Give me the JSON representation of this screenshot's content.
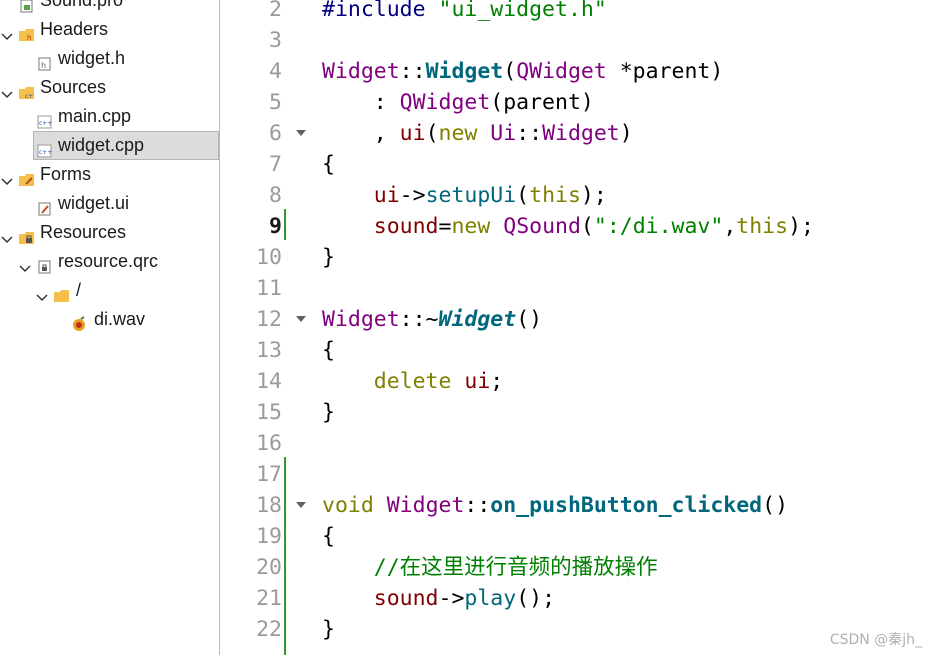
{
  "tree": {
    "items": [
      {
        "label": "Sound.pro",
        "icon": "pro-file-icon"
      },
      {
        "label": "Headers",
        "icon": "headers-folder-icon"
      },
      {
        "label": "widget.h",
        "icon": "header-file-icon"
      },
      {
        "label": "Sources",
        "icon": "sources-folder-icon"
      },
      {
        "label": "main.cpp",
        "icon": "cpp-file-icon"
      },
      {
        "label": "widget.cpp",
        "icon": "cpp-file-icon",
        "selected": true
      },
      {
        "label": "Forms",
        "icon": "forms-folder-icon"
      },
      {
        "label": "widget.ui",
        "icon": "ui-file-icon"
      },
      {
        "label": "Resources",
        "icon": "resources-folder-icon"
      },
      {
        "label": "resource.qrc",
        "icon": "qrc-file-icon"
      },
      {
        "label": "/",
        "icon": "folder-icon"
      },
      {
        "label": "di.wav",
        "icon": "audio-file-icon"
      }
    ]
  },
  "editor": {
    "current_line": 9,
    "lines": [
      {
        "n": "2",
        "tokens": [
          [
            "k-pre",
            "#include "
          ],
          [
            "k-str",
            "\"ui_widget.h\""
          ]
        ]
      },
      {
        "n": "3",
        "tokens": []
      },
      {
        "n": "4",
        "tokens": [
          [
            "k-cls",
            "Widget"
          ],
          [
            "k-pl",
            "::"
          ],
          [
            "k-fn",
            "Widget"
          ],
          [
            "k-pl",
            "("
          ],
          [
            "k-cls",
            "QWidget"
          ],
          [
            "k-pl",
            " *parent)"
          ]
        ]
      },
      {
        "n": "5",
        "tokens": [
          [
            "k-pl",
            "    : "
          ],
          [
            "k-cls",
            "QWidget"
          ],
          [
            "k-pl",
            "(parent)"
          ]
        ]
      },
      {
        "n": "6",
        "tokens": [
          [
            "k-pl",
            "    , "
          ],
          [
            "k-mem",
            "ui"
          ],
          [
            "k-pl",
            "("
          ],
          [
            "k-kw",
            "new "
          ],
          [
            "k-cls",
            "Ui"
          ],
          [
            "k-pl",
            "::"
          ],
          [
            "k-cls",
            "Widget"
          ],
          [
            "k-pl",
            ")"
          ]
        ]
      },
      {
        "n": "7",
        "tokens": [
          [
            "k-pl",
            "{"
          ]
        ]
      },
      {
        "n": "8",
        "tokens": [
          [
            "k-pl",
            "    "
          ],
          [
            "k-mem",
            "ui"
          ],
          [
            "k-pl",
            "->"
          ],
          [
            "k-call",
            "setupUi"
          ],
          [
            "k-pl",
            "("
          ],
          [
            "k-kw",
            "this"
          ],
          [
            "k-pl",
            ");"
          ]
        ]
      },
      {
        "n": "9",
        "tokens": [
          [
            "k-pl",
            "    "
          ],
          [
            "k-mem",
            "sound"
          ],
          [
            "k-pl",
            "="
          ],
          [
            "k-kw",
            "new "
          ],
          [
            "k-cls",
            "QSound"
          ],
          [
            "k-pl",
            "("
          ],
          [
            "k-str",
            "\":/di.wav\""
          ],
          [
            "k-pl",
            ","
          ],
          [
            "k-kw",
            "this"
          ],
          [
            "k-pl",
            ");"
          ]
        ]
      },
      {
        "n": "10",
        "tokens": [
          [
            "k-pl",
            "}"
          ]
        ]
      },
      {
        "n": "11",
        "tokens": []
      },
      {
        "n": "12",
        "tokens": [
          [
            "k-cls",
            "Widget"
          ],
          [
            "k-pl",
            "::~"
          ],
          [
            "k-fni",
            "Widget"
          ],
          [
            "k-pl",
            "()"
          ]
        ]
      },
      {
        "n": "13",
        "tokens": [
          [
            "k-pl",
            "{"
          ]
        ]
      },
      {
        "n": "14",
        "tokens": [
          [
            "k-pl",
            "    "
          ],
          [
            "k-kw",
            "delete "
          ],
          [
            "k-mem",
            "ui"
          ],
          [
            "k-pl",
            ";"
          ]
        ]
      },
      {
        "n": "15",
        "tokens": [
          [
            "k-pl",
            "}"
          ]
        ]
      },
      {
        "n": "16",
        "tokens": []
      },
      {
        "n": "17",
        "tokens": []
      },
      {
        "n": "18",
        "tokens": [
          [
            "k-kw",
            "void "
          ],
          [
            "k-cls",
            "Widget"
          ],
          [
            "k-pl",
            "::"
          ],
          [
            "k-fn",
            "on_pushButton_clicked"
          ],
          [
            "k-pl",
            "()"
          ]
        ]
      },
      {
        "n": "19",
        "tokens": [
          [
            "k-pl",
            "{"
          ]
        ]
      },
      {
        "n": "20",
        "tokens": [
          [
            "k-pl",
            "    "
          ],
          [
            "k-cmt",
            "//在这里进行音频的播放操作"
          ]
        ]
      },
      {
        "n": "21",
        "tokens": [
          [
            "k-pl",
            "    "
          ],
          [
            "k-mem",
            "sound"
          ],
          [
            "k-pl",
            "->"
          ],
          [
            "k-call",
            "play"
          ],
          [
            "k-pl",
            "();"
          ]
        ]
      },
      {
        "n": "22",
        "tokens": [
          [
            "k-pl",
            "}"
          ]
        ]
      }
    ]
  },
  "watermark": "CSDN @秦jh_"
}
